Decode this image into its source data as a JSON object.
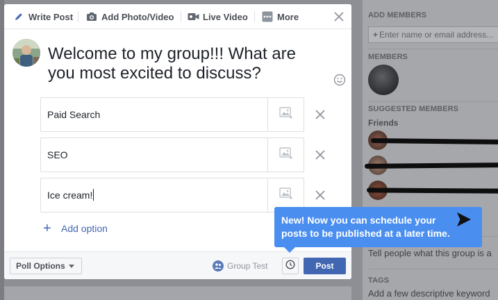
{
  "composer": {
    "tabs": [
      {
        "label": "Write Post",
        "icon": "pencil-icon"
      },
      {
        "label": "Add Photo/Video",
        "icon": "camera-icon"
      },
      {
        "label": "Live Video",
        "icon": "video-camera-icon"
      },
      {
        "label": "More",
        "icon": "more-dots-icon"
      }
    ],
    "question": "Welcome to my group!!! What are you most excited to discuss?",
    "options": [
      {
        "value": "Paid Search"
      },
      {
        "value": "SEO"
      },
      {
        "value": "Ice cream!"
      }
    ],
    "add_option_label": "Add option",
    "footer": {
      "poll_options_label": "Poll Options",
      "audience_label": "Group Test",
      "post_label": "Post"
    }
  },
  "tooltip": {
    "text": "New! Now you can schedule your posts to be published at a later time."
  },
  "sidebar": {
    "add_members_heading": "ADD MEMBERS",
    "add_members_placeholder": "Enter name or email address...",
    "members_heading": "MEMBERS",
    "suggested_heading": "SUGGESTED MEMBERS",
    "friends_label": "Friends",
    "description_prompt": "Tell people what this group is a",
    "tags_heading": "TAGS",
    "tags_prompt": "Add a few descriptive keyword"
  },
  "colors": {
    "accent": "#4267b2",
    "tooltip": "#4a8ef0",
    "overlay": "#8d8f94"
  }
}
